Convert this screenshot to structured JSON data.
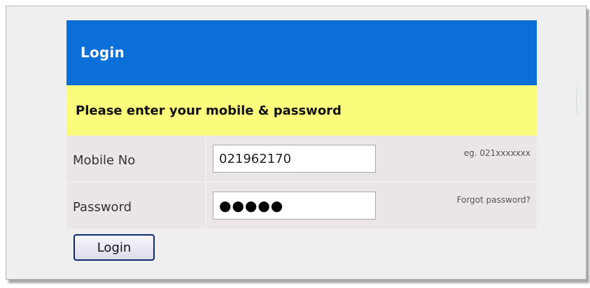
{
  "login": {
    "title": "Login",
    "instruction": "Please enter your mobile & password",
    "mobile": {
      "label": "Mobile No",
      "value": "021962170",
      "hint": "eg. 021xxxxxxx"
    },
    "password": {
      "label": "Password",
      "value": "●●●●●",
      "forgot_label": "Forgot password?"
    },
    "submit_label": "Login"
  },
  "colors": {
    "header_bg": "#0a6fd8",
    "notice_bg": "#fcfc7c",
    "row_bg": "#ebe6e6",
    "button_border": "#10286e"
  }
}
